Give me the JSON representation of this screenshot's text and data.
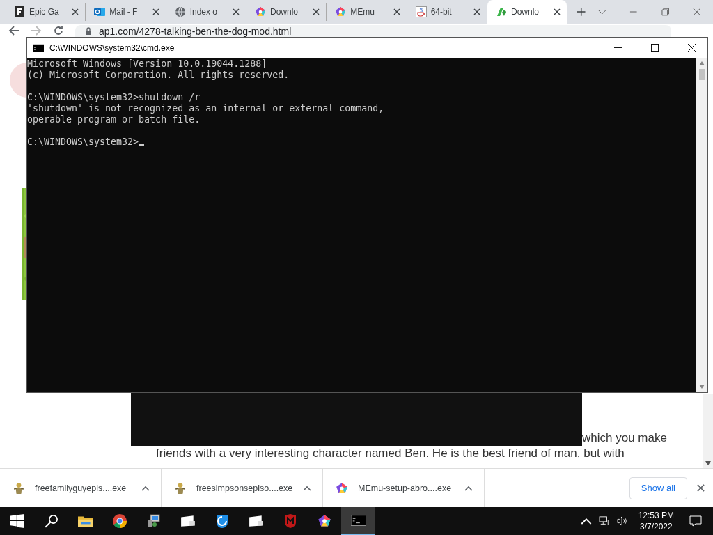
{
  "browser": {
    "tabs": [
      {
        "title": "Epic Ga",
        "selected": false
      },
      {
        "title": "Mail - F",
        "selected": false
      },
      {
        "title": "Index o",
        "selected": false
      },
      {
        "title": "Downlo",
        "selected": false
      },
      {
        "title": "MEmu",
        "selected": false
      },
      {
        "title": "64-bit",
        "selected": false
      },
      {
        "title": "Downlo",
        "selected": true
      }
    ],
    "address": "ap1.com/4278-talking-ben-the-dog-mod.html"
  },
  "page": {
    "lines": [
      "which you make",
      "friends with a very interesting character named Ben. He is the best friend of man, but with"
    ]
  },
  "console_window": {
    "title": "C:\\WINDOWS\\system32\\cmd.exe",
    "blocks": [
      [
        "Microsoft Windows [Version 10.0.19044.1288]",
        "(c) Microsoft Corporation. All rights reserved."
      ],
      [
        "C:\\WINDOWS\\system32>shutdown /r",
        "'shutdown' is not recognized as an internal or external command,",
        "operable program or batch file."
      ],
      [
        "C:\\WINDOWS\\system32>"
      ]
    ],
    "cursor": true
  },
  "downloads": {
    "items": [
      {
        "name": "freefamilyguyepis....exe"
      },
      {
        "name": "freesimpsonsepiso....exe"
      },
      {
        "name": "MEmu-setup-abro....exe"
      }
    ],
    "show_all": "Show all"
  },
  "taskbar": {
    "apps": [
      {
        "kind": "start",
        "selected": false
      },
      {
        "kind": "search",
        "selected": false
      },
      {
        "kind": "folder",
        "selected": false
      },
      {
        "kind": "chrome",
        "selected": false
      },
      {
        "kind": "computer",
        "selected": false
      },
      {
        "kind": "window",
        "selected": false
      },
      {
        "kind": "shield",
        "selected": false
      },
      {
        "kind": "window",
        "selected": false
      },
      {
        "kind": "antivirus",
        "selected": false
      },
      {
        "kind": "pentagon",
        "selected": false
      },
      {
        "kind": "terminal",
        "selected": true
      }
    ],
    "time": "12:53 PM",
    "date": "3/7/2022"
  }
}
